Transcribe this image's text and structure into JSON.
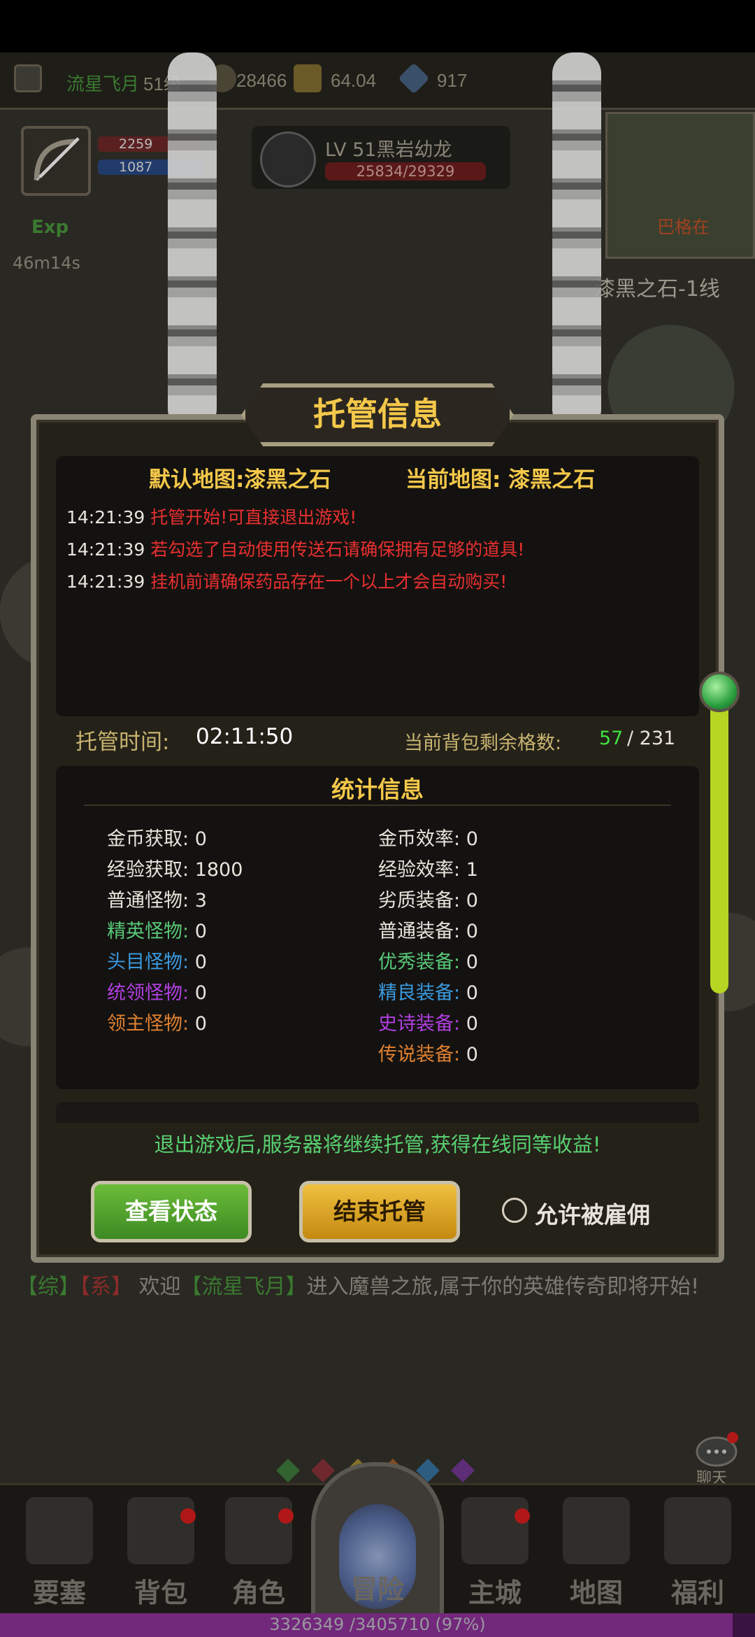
{
  "top_bar": {
    "player_name": "流星飞月",
    "level": "51级",
    "gold": "28466",
    "currency_2": "64.04",
    "gems": "917"
  },
  "hero": {
    "hp": "2259",
    "mp": "1087"
  },
  "monster": {
    "name": "LV 51黑岩幼龙",
    "hp": "25834/29329"
  },
  "exp": {
    "label": "Exp",
    "timer": "46m14s"
  },
  "minimap": {
    "player_marker": "巴格在",
    "map_line": "漆黑之石-1线"
  },
  "dialog": {
    "title": "托管信息",
    "default_map": "默认地图:漆黑之石",
    "current_map": "当前地图: 漆黑之石",
    "log": [
      {
        "time": "14:21:39",
        "msg": "托管开始!可直接退出游戏!"
      },
      {
        "time": "14:21:39",
        "msg": "若勾选了自动使用传送石请确保拥有足够的道具!"
      },
      {
        "time": "14:21:39",
        "msg": "挂机前请确保药品存在一个以上才会自动购买!"
      }
    ],
    "hosting_time_label": "托管时间:",
    "hosting_time_value": "02:11:50",
    "bag_label": "当前背包剩余格数:",
    "bag_free": "57",
    "bag_total": "/ 231",
    "stats_title": "统计信息",
    "stats_left": [
      {
        "label": "金币获取:",
        "value": "0",
        "color": "#e8e4dc"
      },
      {
        "label": "经验获取:",
        "value": "1800",
        "color": "#e8e4dc"
      },
      {
        "label": "普通怪物:",
        "value": "3",
        "color": "#e8e4dc"
      },
      {
        "label": "精英怪物:",
        "value": "0",
        "color": "#58c878"
      },
      {
        "label": "头目怪物:",
        "value": "0",
        "color": "#3a9ae0"
      },
      {
        "label": "统领怪物:",
        "value": "0",
        "color": "#b040e0"
      },
      {
        "label": "领主怪物:",
        "value": "0",
        "color": "#e08030"
      }
    ],
    "stats_right": [
      {
        "label": "金币效率:",
        "value": "0",
        "color": "#e8e4dc"
      },
      {
        "label": "经验效率:",
        "value": "1",
        "color": "#e8e4dc"
      },
      {
        "label": "劣质装备:",
        "value": "0",
        "color": "#e8e4dc"
      },
      {
        "label": "普通装备:",
        "value": "0",
        "color": "#e8e4dc"
      },
      {
        "label": "优秀装备:",
        "value": "0",
        "color": "#58c878"
      },
      {
        "label": "精良装备:",
        "value": "0",
        "color": "#3a9ae0"
      },
      {
        "label": "史诗装备:",
        "value": "0",
        "color": "#b040e0"
      },
      {
        "label": "传说装备:",
        "value": "0",
        "color": "#e08030"
      }
    ],
    "offline_note": "退出游戏后,服务器将继续托管,获得在线同等收益!",
    "btn_status": "查看状态",
    "btn_end": "结束托管",
    "hire_label": "允许被雇佣",
    "hire_checked": false,
    "scroll_position": 0
  },
  "chat": {
    "tag_general": "【综】",
    "tag_system": "【系】",
    "prefix": "欢迎",
    "name": "【流星飞月】",
    "message": "进入魔兽之旅,属于你的英雄传奇即将开始!",
    "button_label": "聊天"
  },
  "nav": [
    {
      "label": "要塞",
      "badge": false
    },
    {
      "label": "背包",
      "badge": true
    },
    {
      "label": "角色",
      "badge": true
    },
    {
      "label": "冒险",
      "badge": false
    },
    {
      "label": "主城",
      "badge": true
    },
    {
      "label": "地图",
      "badge": false
    },
    {
      "label": "福利",
      "badge": false
    }
  ],
  "xp": {
    "text": "3326349 /3405710 (97%)",
    "fraction": 0.97
  },
  "colors": {
    "gold_title": "#f4c84a",
    "log_red": "#e83030",
    "green_note": "#58d070",
    "btn_green": "#4ca02c",
    "btn_gold": "#f0c040"
  }
}
